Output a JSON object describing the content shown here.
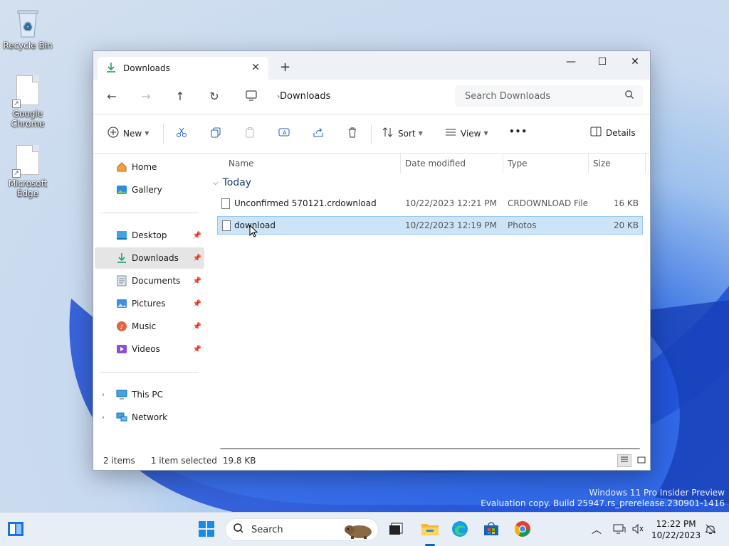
{
  "desktop": {
    "icons": [
      {
        "label": "Recycle Bin"
      },
      {
        "label": "Google Chrome"
      },
      {
        "label": "Microsoft Edge"
      }
    ],
    "watermark": {
      "line1": "Windows 11 Pro Insider Preview",
      "line2": "Evaluation copy. Build 25947.rs_prerelease.230901-1416"
    }
  },
  "window": {
    "tab_title": "Downloads",
    "address": {
      "crumb": "Downloads"
    },
    "search": {
      "placeholder": "Search Downloads"
    },
    "toolbar": {
      "new_label": "New",
      "sort_label": "Sort",
      "view_label": "View",
      "more_label": "•••",
      "details_label": "Details"
    },
    "sidebar": {
      "quick": [
        {
          "label": "Home"
        },
        {
          "label": "Gallery"
        }
      ],
      "pinned": [
        {
          "label": "Desktop"
        },
        {
          "label": "Downloads"
        },
        {
          "label": "Documents"
        },
        {
          "label": "Pictures"
        },
        {
          "label": "Music"
        },
        {
          "label": "Videos"
        }
      ],
      "locations": [
        {
          "label": "This PC"
        },
        {
          "label": "Network"
        }
      ]
    },
    "columns": {
      "name": "Name",
      "date": "Date modified",
      "type": "Type",
      "size": "Size"
    },
    "group_label": "Today",
    "files": [
      {
        "name": "Unconfirmed 570121.crdownload",
        "date": "10/22/2023 12:21 PM",
        "type": "CRDOWNLOAD File",
        "size": "16 KB",
        "selected": false
      },
      {
        "name": "download",
        "date": "10/22/2023 12:19 PM",
        "type": "Photos",
        "size": "20 KB",
        "selected": true
      }
    ],
    "status": {
      "items": "2 items",
      "selected": "1 item selected",
      "size": "19.8 KB"
    }
  },
  "taskbar": {
    "search_label": "Search",
    "time": "12:22 PM",
    "date": "10/22/2023"
  },
  "colors": {
    "accent": "#0067c0",
    "selection": "#cce4f7",
    "download_green": "#1aa06d"
  }
}
